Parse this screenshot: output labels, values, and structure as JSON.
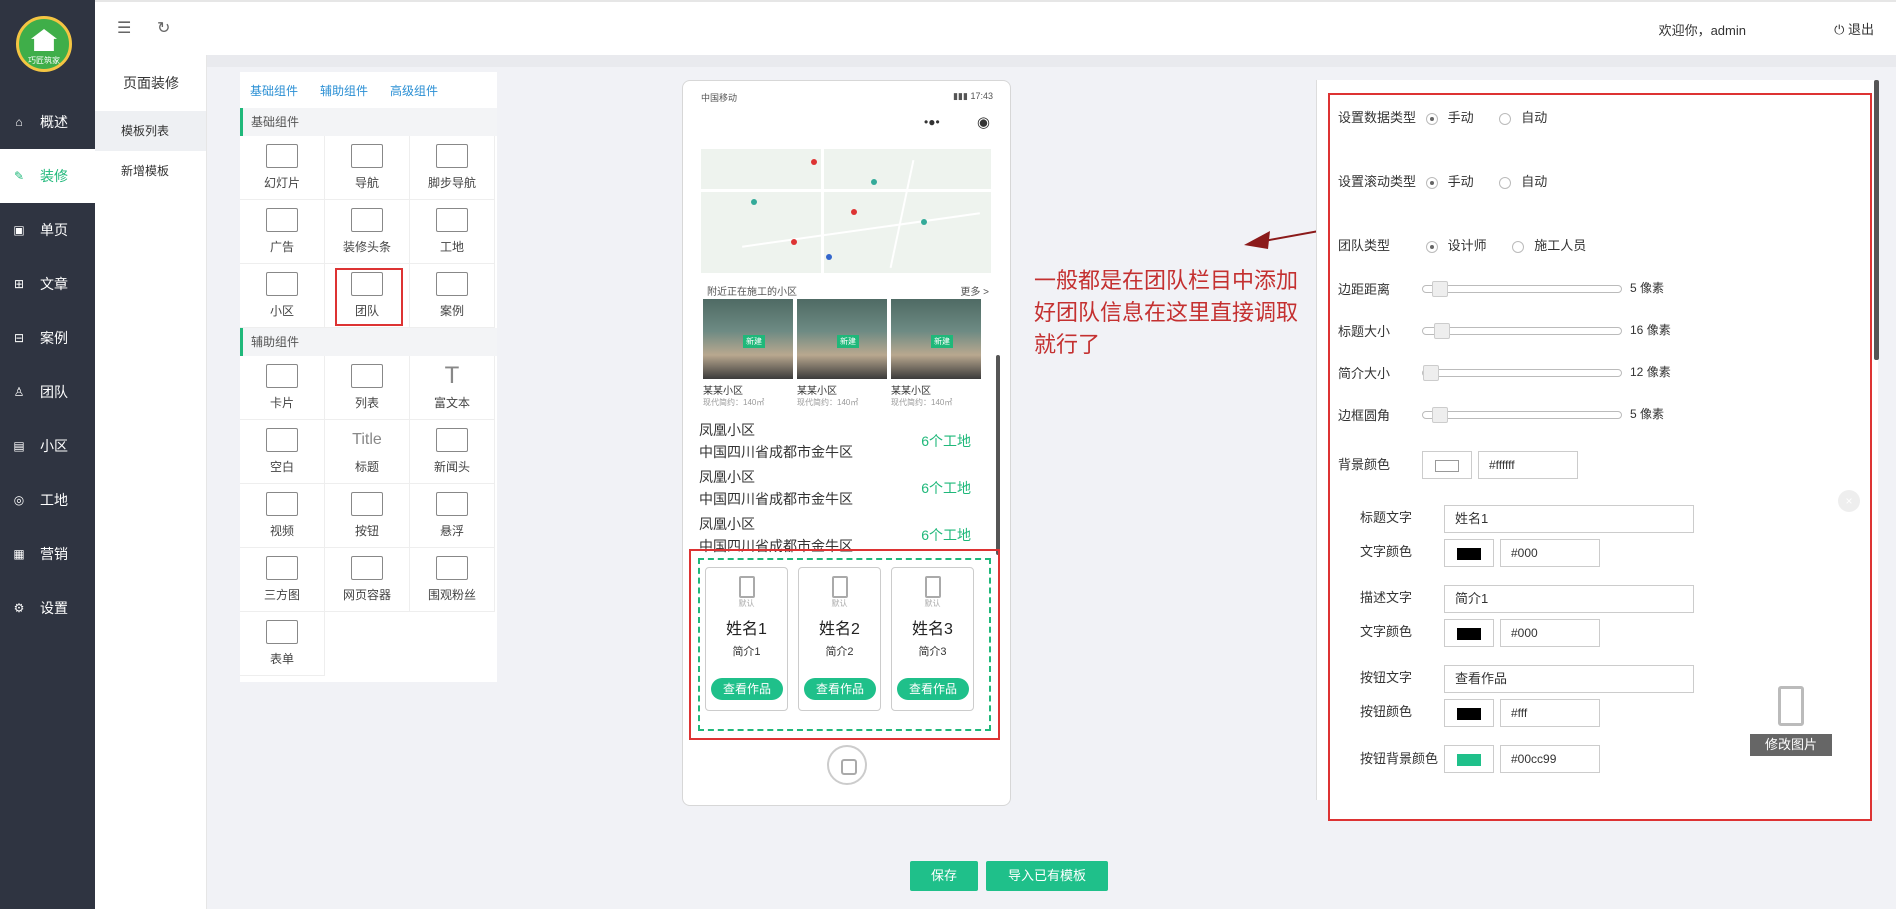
{
  "logo": {
    "text": "巧匠筑家"
  },
  "header": {
    "welcome": "欢迎你，admin",
    "logout": "退出"
  },
  "sidebar": {
    "items": [
      {
        "label": "概述",
        "icon": "home-icon",
        "glyph": "⌂"
      },
      {
        "label": "装修",
        "icon": "pencil-icon",
        "glyph": "✎"
      },
      {
        "label": "单页",
        "icon": "gift-icon",
        "glyph": "▣"
      },
      {
        "label": "文章",
        "icon": "grid-icon",
        "glyph": "⊞"
      },
      {
        "label": "案例",
        "icon": "layout-icon",
        "glyph": "⊟"
      },
      {
        "label": "团队",
        "icon": "user-icon",
        "glyph": "♙"
      },
      {
        "label": "小区",
        "icon": "building-icon",
        "glyph": "▤"
      },
      {
        "label": "工地",
        "icon": "location-icon",
        "glyph": "◎"
      },
      {
        "label": "营销",
        "icon": "marketing-icon",
        "glyph": "▦"
      },
      {
        "label": "设置",
        "icon": "gear-icon",
        "glyph": "⚙"
      }
    ],
    "active": "装修"
  },
  "subsidebar": {
    "title": "页面装修",
    "items": [
      "模板列表",
      "新增模板"
    ]
  },
  "components": {
    "tabs": [
      "基础组件",
      "辅助组件",
      "高级组件"
    ],
    "basic_title": "基础组件",
    "basic": [
      "幻灯片",
      "导航",
      "脚步导航",
      "广告",
      "装修头条",
      "工地",
      "小区",
      "团队",
      "案例"
    ],
    "aux_title": "辅助组件",
    "aux": [
      "卡片",
      "列表",
      "富文本",
      "空白",
      "标题",
      "新闻头",
      "视频",
      "按钮",
      "悬浮",
      "三方图",
      "网页容器",
      "围观粉丝",
      "表单"
    ],
    "title_icon_text": "Title",
    "rich_icon_text": "T"
  },
  "phone": {
    "carrier": "中国移动",
    "time": "17:43",
    "nearby_title": "附近正在施工的小区",
    "more": "更多 >",
    "photos": [
      {
        "tag": "新建",
        "name": "某某小区",
        "desc": "现代简约：140㎡"
      },
      {
        "tag": "新建",
        "name": "某某小区",
        "desc": "现代简约：140㎡"
      },
      {
        "tag": "新建",
        "name": "某某小区",
        "desc": "现代简约：140㎡"
      }
    ],
    "rows": [
      {
        "name": "凤凰小区",
        "addr": "中国四川省成都市金牛区",
        "count": "6个工地"
      },
      {
        "name": "凤凰小区",
        "addr": "中国四川省成都市金牛区",
        "count": "6个工地"
      },
      {
        "name": "凤凰小区",
        "addr": "中国四川省成都市金牛区",
        "count": "6个工地"
      }
    ],
    "team": [
      {
        "avatar": "默认",
        "name": "姓名1",
        "intro": "简介1",
        "btn": "查看作品"
      },
      {
        "avatar": "默认",
        "name": "姓名2",
        "intro": "简介2",
        "btn": "查看作品"
      },
      {
        "avatar": "默认",
        "name": "姓名3",
        "intro": "简介3",
        "btn": "查看作品"
      }
    ]
  },
  "annotation": "一般都是在团队栏目中添加好团队信息在这里直接调取就行了",
  "settings": {
    "data_type": {
      "label": "设置数据类型",
      "options": [
        "手动",
        "自动"
      ],
      "selected": "手动"
    },
    "scroll_type": {
      "label": "设置滚动类型",
      "options": [
        "手动",
        "自动"
      ],
      "selected": "手动"
    },
    "team_type": {
      "label": "团队类型",
      "options": [
        "设计师",
        "施工人员"
      ],
      "selected": "设计师"
    },
    "margin": {
      "label": "边距距离",
      "value": "5",
      "unit": "像素",
      "level": 0.05
    },
    "title_size": {
      "label": "标题大小",
      "value": "16",
      "unit": "像素",
      "level": 0.06
    },
    "intro_size": {
      "label": "简介大小",
      "value": "12",
      "unit": "像素",
      "level": 0.0
    },
    "radius": {
      "label": "边框圆角",
      "value": "5",
      "unit": "像素",
      "level": 0.05
    },
    "bg_color": {
      "label": "背景颜色",
      "value": "#ffffff",
      "swatch": "#ffffff"
    },
    "title_text": {
      "label": "标题文字",
      "value": "姓名1"
    },
    "title_color": {
      "label": "文字颜色",
      "value": "#000",
      "swatch": "#000000"
    },
    "desc_text": {
      "label": "描述文字",
      "value": "简介1"
    },
    "desc_color": {
      "label": "文字颜色",
      "value": "#000",
      "swatch": "#000000"
    },
    "btn_text": {
      "label": "按钮文字",
      "value": "查看作品"
    },
    "btn_color": {
      "label": "按钮颜色",
      "value": "#fff",
      "swatch": "#000000"
    },
    "btn_bg": {
      "label": "按钮背景颜色",
      "value": "#00cc99",
      "swatch": "#1fc08a"
    },
    "edit_image": "修改图片",
    "close": "×"
  },
  "buttons": {
    "save": "保存",
    "import": "导入已有模板"
  },
  "colors": {
    "accent": "#1fb87a",
    "sidebar": "#2f3441",
    "highlight": "#dd3333"
  }
}
